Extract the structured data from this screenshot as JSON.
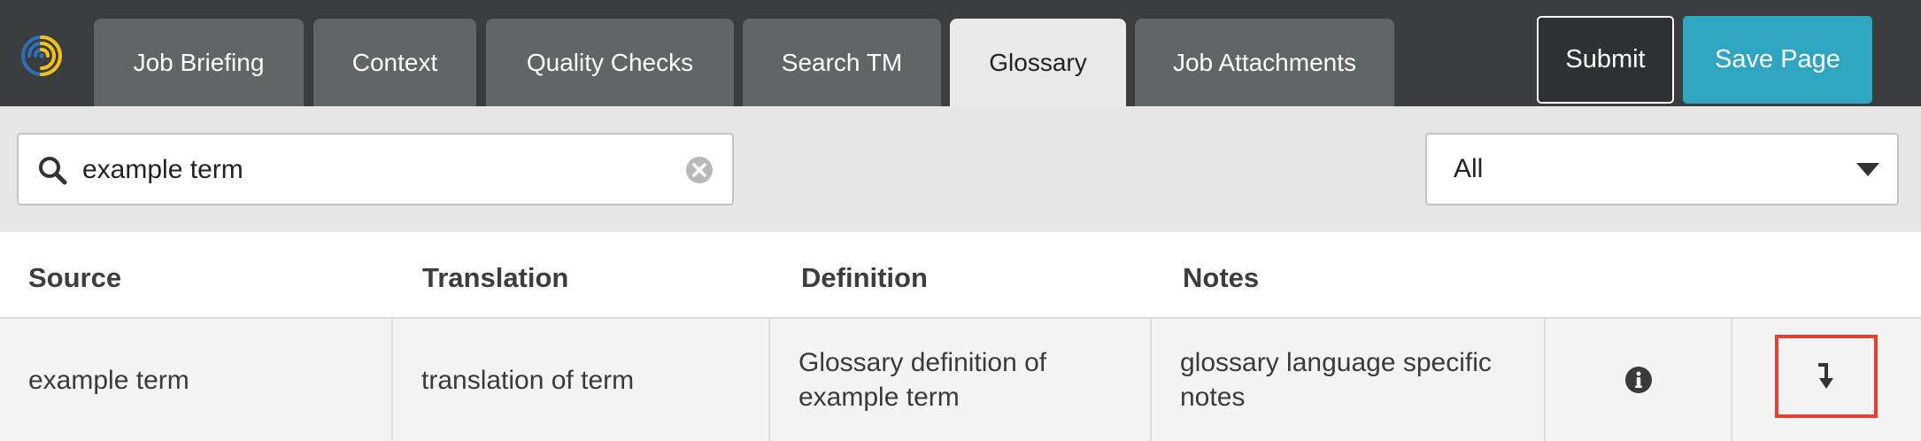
{
  "toolbar": {
    "tabs": [
      {
        "label": "Job Briefing",
        "active": false
      },
      {
        "label": "Context",
        "active": false
      },
      {
        "label": "Quality Checks",
        "active": false
      },
      {
        "label": "Search TM",
        "active": false
      },
      {
        "label": "Glossary",
        "active": true
      },
      {
        "label": "Job Attachments",
        "active": false
      }
    ],
    "submit_label": "Submit",
    "save_label": "Save Page"
  },
  "search": {
    "value": "example term",
    "filter_value": "All"
  },
  "table": {
    "headers": {
      "source": "Source",
      "translation": "Translation",
      "definition": "Definition",
      "notes": "Notes"
    },
    "rows": [
      {
        "source": "example term",
        "translation": "translation of term",
        "definition": "Glossary definition of example term",
        "notes": "glossary language specific notes"
      }
    ]
  },
  "icons": {
    "logo": "fingerprint-logo-icon",
    "search": "search-icon",
    "clear": "clear-icon",
    "caret": "chevron-down-icon",
    "info": "info-icon",
    "insert": "insert-arrow-icon"
  },
  "colors": {
    "topbar": "#3a3d3f",
    "tab": "#5f6665",
    "tab_active": "#e9e9e9",
    "save_button": "#2ea6c2",
    "highlight_border": "#e8402e"
  }
}
